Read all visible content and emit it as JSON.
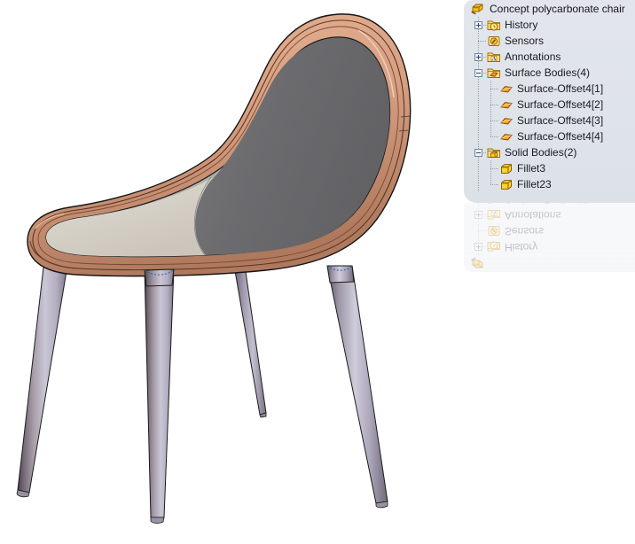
{
  "app": {
    "title": "Concept polycarbonate chair",
    "background_color": "#ffffff",
    "panel_color": "#e0e5eb"
  },
  "feature_tree": {
    "root": {
      "label": "Concept polycarbonate chair",
      "icon": "part-document-icon"
    },
    "items": [
      {
        "label": "History",
        "icon": "history-folder-icon",
        "indent": 1,
        "expander": "plus",
        "last": false
      },
      {
        "label": "Sensors",
        "icon": "sensors-icon",
        "indent": 1,
        "expander": "none",
        "last": false
      },
      {
        "label": "Annotations",
        "icon": "annotations-folder-icon",
        "indent": 1,
        "expander": "plus",
        "last": false
      },
      {
        "label": "Surface Bodies(4)",
        "icon": "surface-bodies-folder-icon",
        "indent": 1,
        "expander": "minus",
        "last": false
      },
      {
        "label": "Surface-Offset4[1]",
        "icon": "surface-body-icon",
        "indent": 2,
        "expander": "none",
        "last": false
      },
      {
        "label": "Surface-Offset4[2]",
        "icon": "surface-body-icon",
        "indent": 2,
        "expander": "none",
        "last": false
      },
      {
        "label": "Surface-Offset4[3]",
        "icon": "surface-body-icon",
        "indent": 2,
        "expander": "none",
        "last": false
      },
      {
        "label": "Surface-Offset4[4]",
        "icon": "surface-body-icon",
        "indent": 2,
        "expander": "none",
        "last": true
      },
      {
        "label": "Solid Bodies(2)",
        "icon": "solid-bodies-folder-icon",
        "indent": 1,
        "expander": "minus",
        "last": false
      },
      {
        "label": "Fillet3",
        "icon": "solid-body-icon",
        "indent": 2,
        "expander": "none",
        "last": false
      },
      {
        "label": "Fillet23",
        "icon": "solid-body-icon",
        "indent": 2,
        "expander": "none",
        "last": true
      }
    ]
  },
  "model": {
    "name": "concept-polycarbonate-chair",
    "description": "Four-legged moulded shell chair, rendered in shaded-with-edges view",
    "colors": {
      "shell_face": "#6b6b6d",
      "seat_face": "#d9d4cb",
      "shell_rim": "#d9a487",
      "shell_rim_dark": "#6c3c2a",
      "leg_light": "#c9c7d8",
      "leg_mid": "#9a95a8",
      "leg_dark": "#6f6675",
      "edge": "#1a1a1a"
    }
  }
}
